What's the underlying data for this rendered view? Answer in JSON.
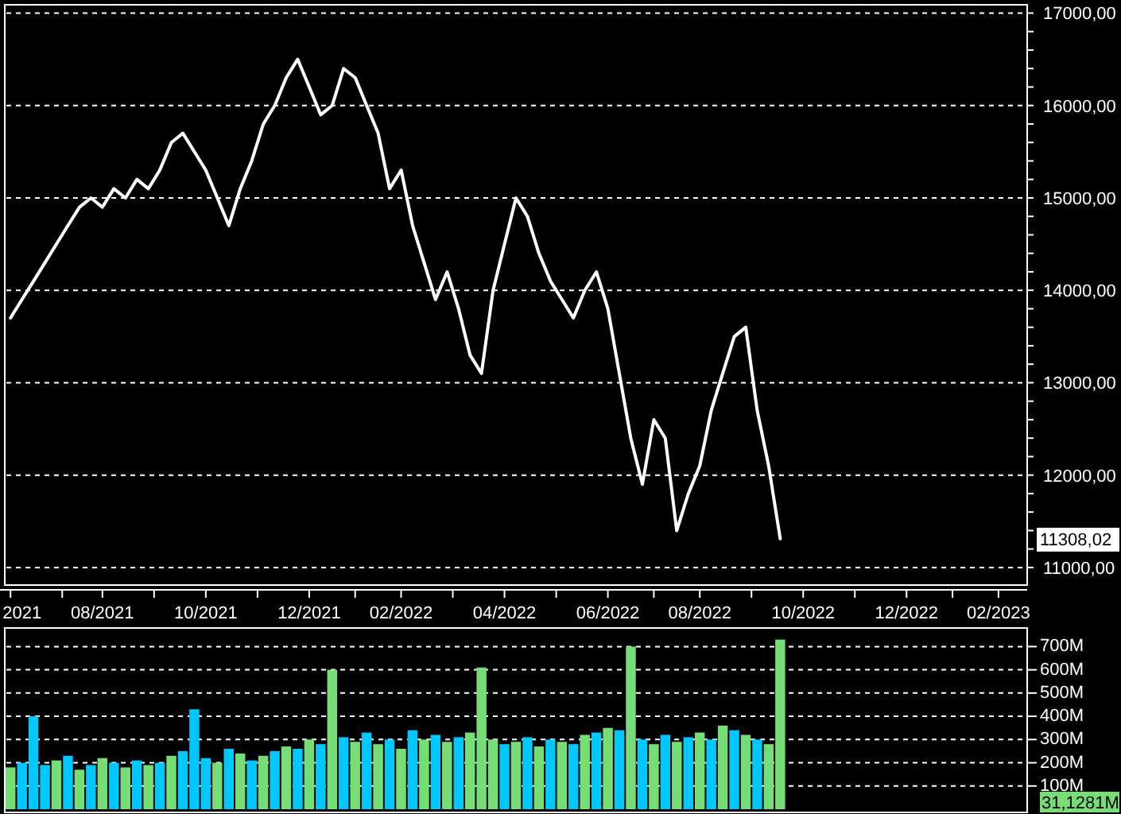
{
  "price_panel": {
    "last_value": "11308,02",
    "chart_data": {
      "type": "line",
      "grid": true,
      "ylim": [
        10810,
        17090
      ],
      "categories": [
        null,
        "2021",
        null,
        null,
        null,
        null,
        null,
        null,
        "08/2021",
        null,
        null,
        null,
        null,
        null,
        null,
        null,
        null,
        "10/2021",
        null,
        null,
        null,
        null,
        null,
        null,
        null,
        null,
        "12/2021",
        null,
        null,
        null,
        null,
        null,
        null,
        null,
        "02/2022",
        null,
        null,
        null,
        null,
        null,
        null,
        null,
        null,
        "04/2022",
        null,
        null,
        null,
        null,
        null,
        null,
        null,
        null,
        "06/2022",
        null,
        null,
        null,
        null,
        null,
        null,
        null,
        "08/2022",
        null,
        null,
        null,
        null,
        null,
        null,
        null,
        null,
        "10/2022",
        null,
        null,
        null,
        null,
        null,
        null,
        null,
        null,
        "12/2022",
        null,
        null,
        null,
        null,
        null,
        null,
        null,
        "02/2023",
        null,
        null
      ],
      "series": [
        {
          "color": "#ffffff",
          "values": [
            13700,
            13900,
            14100,
            14300,
            14500,
            14700,
            14900,
            15000,
            14900,
            15100,
            15000,
            15200,
            15100,
            15300,
            15600,
            15700,
            15500,
            15300,
            15000,
            14700,
            15100,
            15400,
            15800,
            16000,
            16300,
            16500,
            16200,
            15900,
            16000,
            16400,
            16300,
            16000,
            15700,
            15100,
            15300,
            14700,
            14300,
            13900,
            14200,
            13800,
            13300,
            13100,
            14000,
            14500,
            15000,
            14800,
            14400,
            14100,
            13900,
            13700,
            14000,
            14200,
            13800,
            13100,
            12400,
            11900,
            12600,
            12400,
            11400,
            11800,
            12100,
            12700,
            13100,
            13500,
            13600,
            12700,
            12100,
            11310,
            null,
            null,
            null,
            null,
            null,
            null,
            null,
            null,
            null,
            null,
            null,
            null,
            null,
            null,
            null,
            null,
            null,
            null,
            null,
            null,
            null
          ]
        }
      ],
      "yticks": [
        {
          "value": 11000,
          "label": "11000,00"
        },
        {
          "value": 12000,
          "label": "12000,00"
        },
        {
          "value": 13000,
          "label": "13000,00"
        },
        {
          "value": 14000,
          "label": "14000,00"
        },
        {
          "value": 15000,
          "label": "15000,00"
        },
        {
          "value": 16000,
          "label": "16000,00"
        },
        {
          "value": 17000,
          "label": "17000,00"
        }
      ]
    }
  },
  "volume_panel": {
    "last_value": "31,1281M",
    "chart_data": {
      "type": "bar",
      "grid": true,
      "stacked": true,
      "ylim": [
        0,
        780
      ],
      "categories": [
        null,
        null,
        null,
        null,
        null,
        null,
        null,
        null,
        null,
        null,
        null,
        null,
        null,
        null,
        null,
        null,
        null,
        null,
        null,
        null,
        null,
        null,
        null,
        null,
        null,
        null,
        null,
        null,
        null,
        null,
        null,
        null,
        null,
        null,
        null,
        null,
        null,
        null,
        null,
        null,
        null,
        null,
        null,
        null,
        null,
        null,
        null,
        null,
        null,
        null,
        null,
        null,
        null,
        null,
        null,
        null,
        null,
        null,
        null,
        null,
        null,
        null,
        null,
        null,
        null,
        null,
        null,
        null,
        null,
        null,
        null,
        null,
        null,
        null,
        null,
        null,
        null,
        null,
        null,
        null,
        null,
        null,
        null,
        null,
        null,
        null,
        null,
        null,
        null
      ],
      "series": [
        {
          "color": "#77dd77",
          "values": [
            180,
            null,
            null,
            null,
            210,
            null,
            170,
            null,
            220,
            null,
            180,
            null,
            190,
            null,
            230,
            null,
            null,
            null,
            200,
            null,
            240,
            null,
            230,
            null,
            270,
            null,
            300,
            null,
            600,
            null,
            290,
            null,
            280,
            null,
            260,
            null,
            300,
            null,
            290,
            null,
            330,
            610,
            300,
            null,
            290,
            null,
            270,
            null,
            290,
            null,
            320,
            null,
            350,
            null,
            700,
            null,
            280,
            null,
            290,
            null,
            330,
            null,
            360,
            null,
            320,
            null,
            280,
            730,
            null,
            null,
            null,
            null,
            null,
            null,
            null,
            null,
            null,
            null,
            null,
            null,
            null,
            null,
            null,
            null,
            null,
            null,
            null,
            null,
            null
          ]
        },
        {
          "color": "#00c8ff",
          "values": [
            null,
            200,
            400,
            190,
            null,
            230,
            null,
            190,
            null,
            200,
            null,
            210,
            null,
            200,
            null,
            250,
            430,
            220,
            null,
            260,
            null,
            210,
            null,
            250,
            null,
            260,
            null,
            280,
            null,
            310,
            null,
            330,
            null,
            300,
            null,
            340,
            null,
            320,
            null,
            310,
            null,
            null,
            null,
            280,
            null,
            310,
            null,
            300,
            null,
            280,
            null,
            330,
            null,
            340,
            null,
            300,
            null,
            320,
            null,
            310,
            null,
            300,
            null,
            340,
            null,
            300,
            null,
            null,
            null,
            null,
            null,
            null,
            null,
            null,
            null,
            null,
            null,
            null,
            null,
            null,
            null,
            null,
            null,
            null,
            null,
            null,
            null,
            null,
            null
          ]
        }
      ],
      "yticks": [
        {
          "value": 100,
          "label": "100M"
        },
        {
          "value": 200,
          "label": "200M"
        },
        {
          "value": 300,
          "label": "300M"
        },
        {
          "value": 400,
          "label": "400M"
        },
        {
          "value": 500,
          "label": "500M"
        },
        {
          "value": 600,
          "label": "600M"
        },
        {
          "value": 700,
          "label": "700M"
        }
      ]
    }
  }
}
